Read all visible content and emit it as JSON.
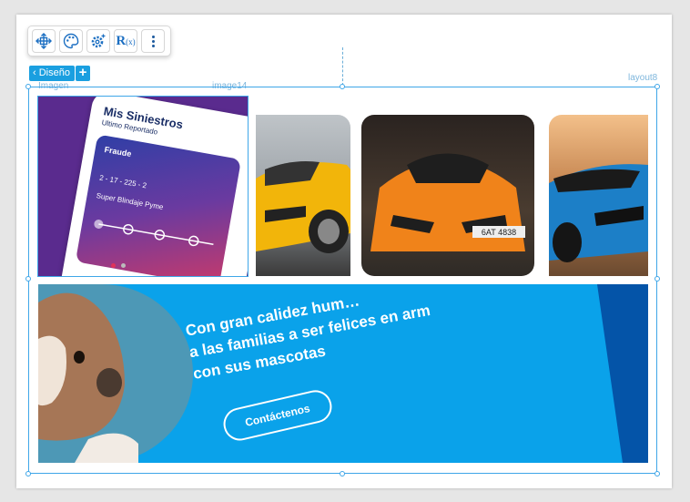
{
  "toolbar": {
    "move_icon": "move-arrows-icon",
    "palette_icon": "palette-icon",
    "settings_icon": "gear-sparkle-icon",
    "rx_label": "R",
    "rx_sub": "(x)",
    "more_icon": "kebab-icon"
  },
  "design_button": {
    "label": "‹ Diseño",
    "plus": "+"
  },
  "labels": {
    "imagen": "Imagen",
    "image14": "image14",
    "layout8": "layout8"
  },
  "phone": {
    "title": "Mis Siniestros",
    "subtitle": "Ultimo Reportado",
    "card_type": "Fraude",
    "card_number": "2 - 17 - 225 - 2",
    "card_product": "Super Blindaje Pyme"
  },
  "banner": {
    "line1": "Con gran calidez hum…",
    "line1_tail": "felices en arm…",
    "line2": "a las familias a ser felices en arm",
    "line3": "con sus mascotas",
    "cta": "Contáctenos"
  },
  "colors": {
    "accent": "#1a9fe0",
    "banner": "#0aa2ea",
    "phone_bg": "#5a2b8e"
  }
}
